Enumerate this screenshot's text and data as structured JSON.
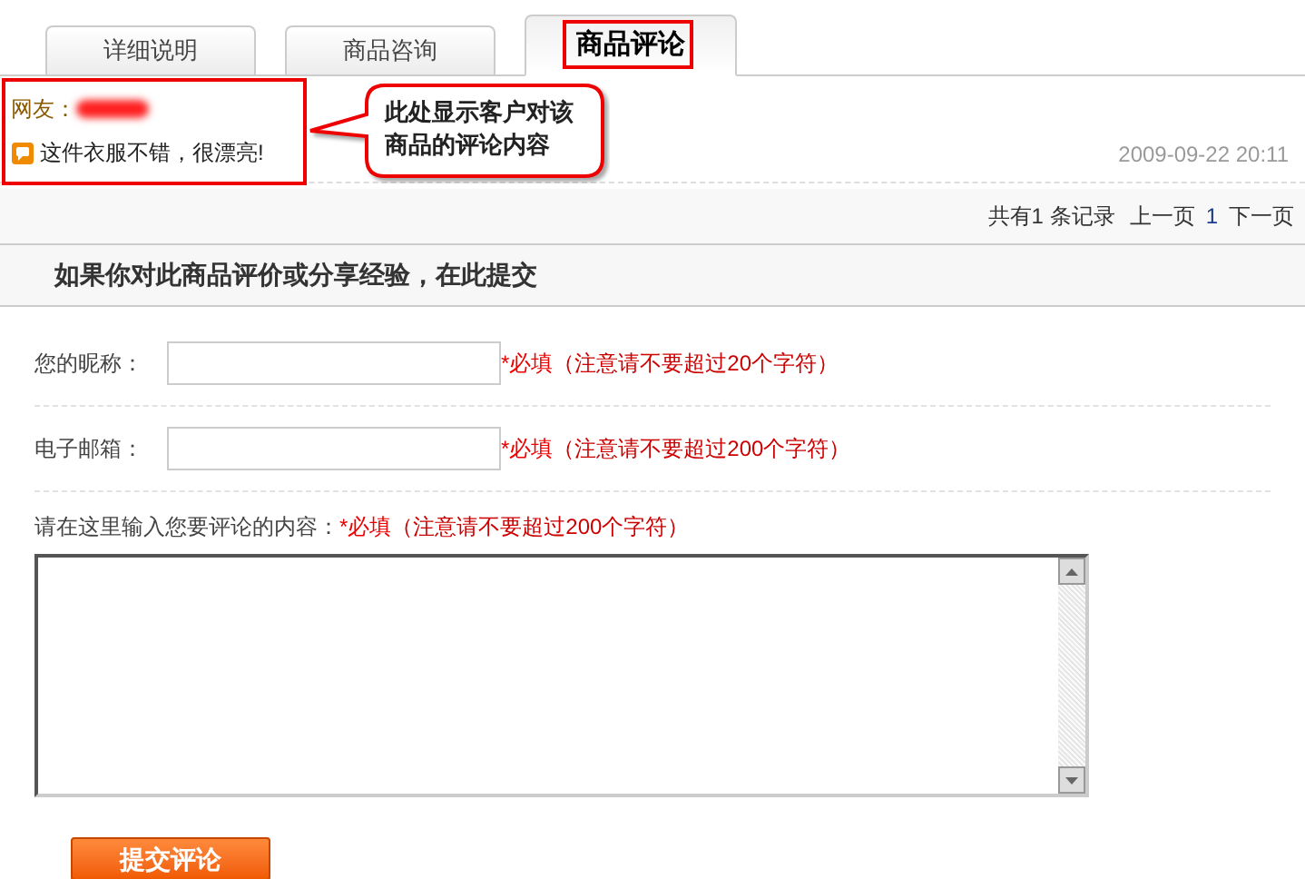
{
  "tabs": [
    {
      "label": "详细说明",
      "selected": false
    },
    {
      "label": "商品咨询",
      "selected": false
    },
    {
      "label": "商品评论",
      "selected": true
    }
  ],
  "review": {
    "user_label": "网友：",
    "comment": "这件衣服不错，很漂亮!",
    "date": "2009-09-22 20:11"
  },
  "callout": {
    "text": "此处显示客户对该商品的评论内容"
  },
  "pagination": {
    "summary": "共有1 条记录",
    "prev": "上一页",
    "page": "1",
    "next": "下一页"
  },
  "form": {
    "title": "如果你对此商品评价或分享经验，在此提交",
    "fields": [
      {
        "kind": "input",
        "label": "您的昵称：",
        "required": "*必填",
        "hint": "（注意请不要超过20个字符）"
      },
      {
        "kind": "input",
        "label": "电子邮箱：",
        "required": "*必填",
        "hint": "（注意请不要超过200个字符）"
      },
      {
        "kind": "textarea",
        "label": "请在这里输入您要评论的内容：",
        "required": "*必填",
        "hint": "（注意请不要超过200个字符）"
      }
    ],
    "submit": "提交评论"
  }
}
